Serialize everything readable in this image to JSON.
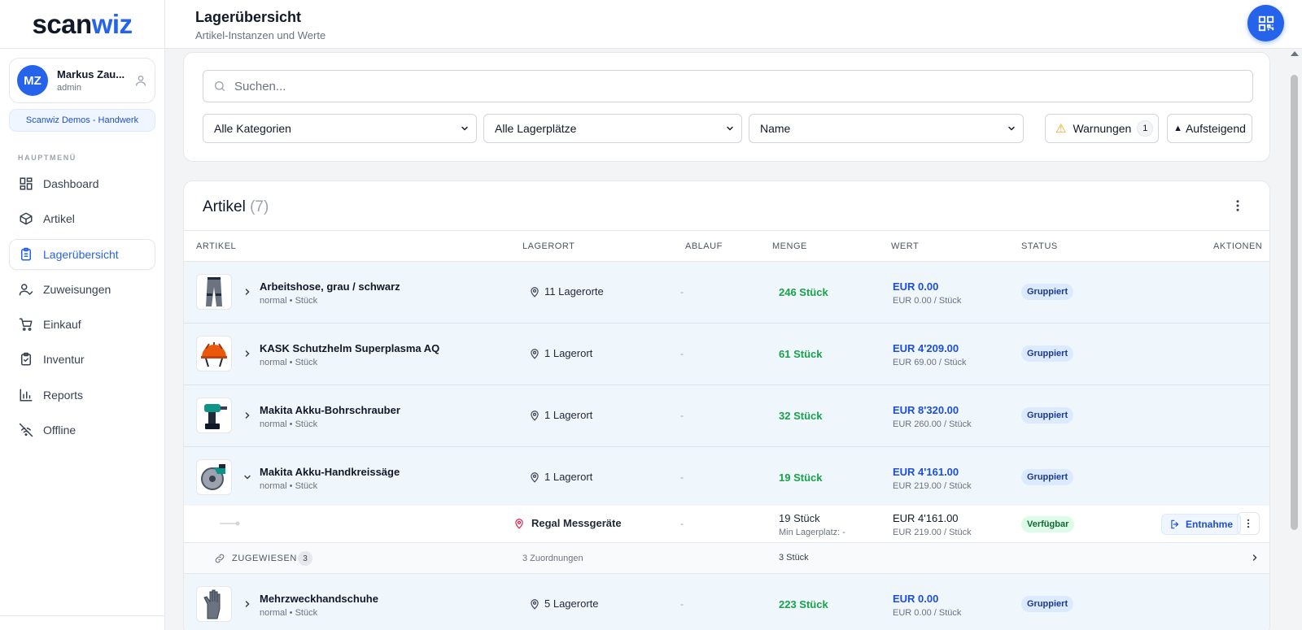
{
  "brand": {
    "part1": "scan",
    "part2": "wiz"
  },
  "user": {
    "initials": "MZ",
    "name": "Markus Zau...",
    "role": "admin"
  },
  "tenant": "Scanwiz Demos - Handwerk",
  "menu_title": "HAUPTMENÜ",
  "nav": [
    {
      "label": "Dashboard",
      "icon": "dashboard-icon"
    },
    {
      "label": "Artikel",
      "icon": "box-icon"
    },
    {
      "label": "Lagerübersicht",
      "icon": "clipboard-icon",
      "active": true
    },
    {
      "label": "Zuweisungen",
      "icon": "user-check-icon"
    },
    {
      "label": "Einkauf",
      "icon": "cart-icon"
    },
    {
      "label": "Inventur",
      "icon": "clipboard-check-icon"
    },
    {
      "label": "Reports",
      "icon": "bar-chart-icon"
    },
    {
      "label": "Offline",
      "icon": "wifi-off-icon"
    }
  ],
  "header": {
    "title": "Lagerübersicht",
    "subtitle": "Artikel-Instanzen und Werte"
  },
  "filters": {
    "search_placeholder": "Suchen...",
    "category": "Alle Kategorien",
    "storage": "Alle Lagerplätze",
    "sort_field": "Name",
    "warnings_label": "Warnungen",
    "warnings_count": "1",
    "sort_order": "Aufsteigend"
  },
  "table": {
    "title": "Artikel",
    "count": "(7)",
    "columns": [
      "ARTIKEL",
      "LAGERORT",
      "ABLAUF",
      "MENGE",
      "WERT",
      "STATUS",
      "AKTIONEN"
    ],
    "rows": [
      {
        "name": "Arbeitshose, grau / schwarz",
        "sub": "normal • Stück",
        "location": "11 Lagerorte",
        "ablauf": "-",
        "qty": "246 Stück",
        "value": "EUR 0.00",
        "value_sub": "EUR 0.00 / Stück",
        "status": "Gruppiert",
        "icon": "pants-icon"
      },
      {
        "name": "KASK Schutzhelm Superplasma AQ",
        "sub": "normal • Stück",
        "location": "1 Lagerort",
        "ablauf": "-",
        "qty": "61 Stück",
        "value": "EUR 4'209.00",
        "value_sub": "EUR 69.00 / Stück",
        "status": "Gruppiert",
        "icon": "helmet-icon"
      },
      {
        "name": "Makita Akku-Bohrschrauber",
        "sub": "normal • Stück",
        "location": "1 Lagerort",
        "ablauf": "-",
        "qty": "32 Stück",
        "value": "EUR 8'320.00",
        "value_sub": "EUR 260.00 / Stück",
        "status": "Gruppiert",
        "icon": "drill-icon"
      },
      {
        "name": "Makita Akku-Handkreissäge",
        "sub": "normal • Stück",
        "location": "1 Lagerort",
        "ablauf": "-",
        "qty": "19 Stück",
        "value": "EUR 4'161.00",
        "value_sub": "EUR 219.00 / Stück",
        "status": "Gruppiert",
        "icon": "saw-icon"
      },
      {
        "name": "Mehrzweckhandschuhe",
        "sub": "normal • Stück",
        "location": "5 Lagerorte",
        "ablauf": "-",
        "qty": "223 Stück",
        "value": "EUR 0.00",
        "value_sub": "EUR 0.00 / Stück",
        "status": "Gruppiert",
        "icon": "glove-icon"
      }
    ],
    "instance": {
      "location": "Regal Messgeräte",
      "ablauf": "-",
      "qty": "19 Stück",
      "min": "Min Lagerplatz: -",
      "value": "EUR 4'161.00",
      "value_sub": "EUR 219.00 / Stück",
      "status": "Verfügbar",
      "action": "Entnahme"
    },
    "assigned": {
      "label": "ZUGEWIESEN",
      "count": "3",
      "mappings": "3 Zuordnungen",
      "qty": "3 Stück"
    }
  },
  "colors": {
    "accent": "#2563eb",
    "qty_green": "#16a34a",
    "value_blue": "#1d4ed8",
    "row_bg": "#eff6fc"
  }
}
